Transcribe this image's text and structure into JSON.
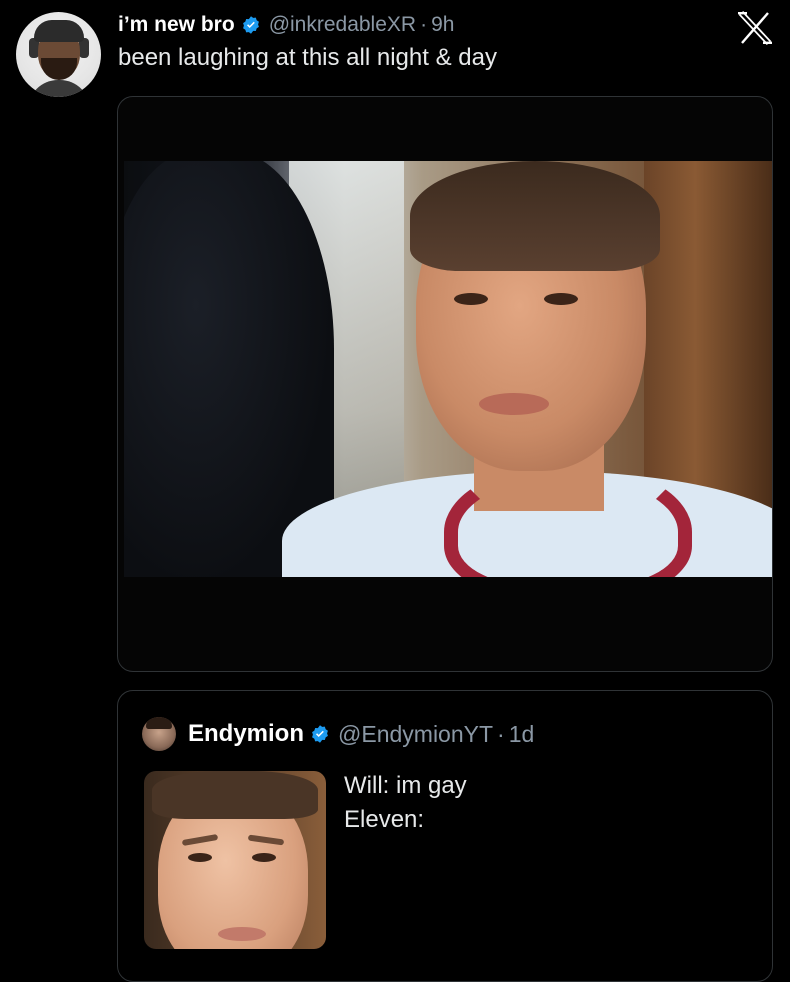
{
  "tweet": {
    "display_name": "i’m new bro",
    "handle": "@inkredableXR",
    "separator": "·",
    "time": "9h",
    "text": "been laughing at this all night & day",
    "verified": true
  },
  "quoted": {
    "display_name": "Endymion",
    "handle": "@EndymionYT",
    "separator": "·",
    "time": "1d",
    "verified": true,
    "lines": [
      "Will: im gay",
      "Eleven:"
    ]
  },
  "colors": {
    "background": "#000000",
    "text": "#e7e9ea",
    "muted": "#8b98a5",
    "verified": "#1d9bf0",
    "border": "#2f3336"
  },
  "icons": {
    "verified": "verified-badge-icon",
    "brand": "x-logo-icon"
  }
}
